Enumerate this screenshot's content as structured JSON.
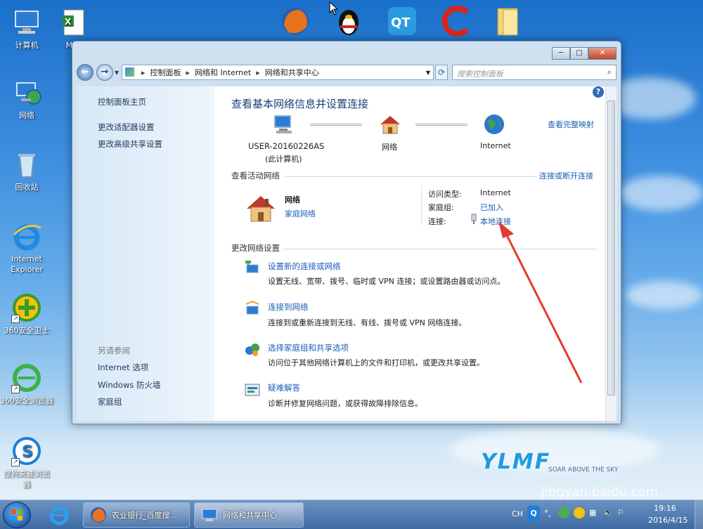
{
  "desktop": {
    "icons": [
      {
        "label": "计算机",
        "icon": "computer-icon"
      },
      {
        "label": "网络",
        "icon": "network-icon"
      },
      {
        "label": "回收站",
        "icon": "recycle-bin-icon"
      },
      {
        "label": "Internet Explorer",
        "icon": "ie-icon"
      },
      {
        "label": "360安全卫士",
        "icon": "360-guard-icon"
      },
      {
        "label": "360安全浏览器",
        "icon": "360-browser-icon"
      },
      {
        "label": "搜狗高速浏览器",
        "icon": "sogou-browser-icon"
      }
    ],
    "partial_label": "Mic"
  },
  "window": {
    "breadcrumb": [
      "控制面板",
      "网络和 Internet",
      "网络和共享中心"
    ],
    "search_placeholder": "搜索控制面板",
    "sidebar": {
      "top_links": [
        "控制面板主页",
        "更改适配器设置",
        "更改高级共享设置"
      ],
      "see_also_heading": "另请参阅",
      "see_also_links": [
        "Internet 选项",
        "Windows 防火墙",
        "家庭组"
      ]
    },
    "main": {
      "title": "查看基本网络信息并设置连接",
      "view_full_map": "查看完整映射",
      "map": {
        "computer_name": "USER-20160226AS",
        "computer_sub": "(此计算机)",
        "network": "网络",
        "internet": "Internet"
      },
      "active_heading": "查看活动网络",
      "connect_disconnect": "连接或断开连接",
      "active_network": {
        "name": "网络",
        "type": "家庭网络",
        "access_type_label": "访问类型:",
        "access_type_value": "Internet",
        "homegroup_label": "家庭组:",
        "homegroup_value": "已加入",
        "connection_label": "连接:",
        "connection_value": "本地连接"
      },
      "change_heading": "更改网络设置",
      "tasks": [
        {
          "link": "设置新的连接或网络",
          "desc": "设置无线、宽带、拨号、临时或 VPN 连接；或设置路由器或访问点。"
        },
        {
          "link": "连接到网络",
          "desc": "连接到或重新连接到无线、有线、拨号或 VPN 网络连接。"
        },
        {
          "link": "选择家庭组和共享选项",
          "desc": "访问位于其他网络计算机上的文件和打印机，或更改共享设置。"
        },
        {
          "link": "疑难解答",
          "desc": "诊断并修复网络问题，或获得故障排除信息。"
        }
      ]
    }
  },
  "taskbar": {
    "apps": [
      "农业银行_百度搜...",
      "网络和共享中心"
    ],
    "lang": "CH",
    "time": "19:16",
    "date": "2016/4/15"
  },
  "watermark": {
    "logo": "YLMF",
    "slogan": "SOAR ABOVE THE SKY",
    "baidu_url": "jingyan.baidu.com"
  }
}
